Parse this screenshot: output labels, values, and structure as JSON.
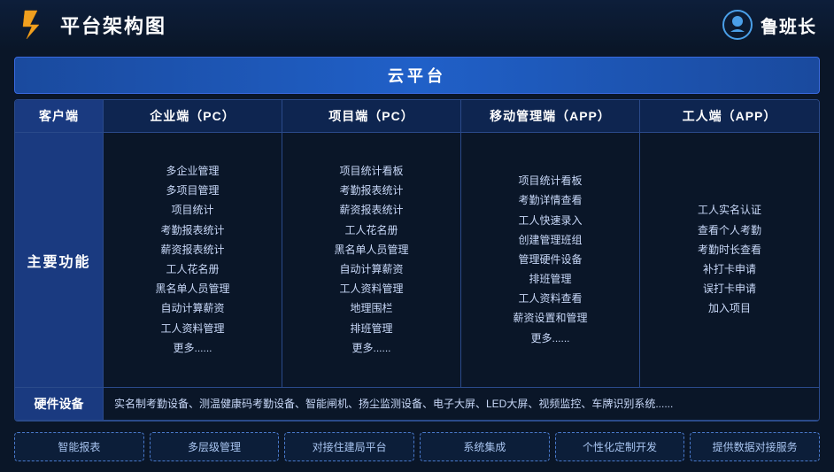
{
  "header": {
    "title": "平台架构图",
    "brand": "鲁班长"
  },
  "cloud_banner": "云平台",
  "columns": {
    "client": "客户端",
    "enterprise": "企业端（PC）",
    "project": "项目端（PC）",
    "mobile": "移动管理端（APP）",
    "worker": "工人端（APP）"
  },
  "main_label": "主要功能",
  "enterprise_features": [
    "多企业管理",
    "多项目管理",
    "项目统计",
    "考勤报表统计",
    "薪资报表统计",
    "工人花名册",
    "黑名单人员管理",
    "自动计算薪资",
    "工人资料管理",
    "更多......"
  ],
  "project_features": [
    "项目统计看板",
    "考勤报表统计",
    "薪资报表统计",
    "工人花名册",
    "黑名单人员管理",
    "自动计算薪资",
    "工人资料管理",
    "地理围栏",
    "排班管理",
    "更多......"
  ],
  "mobile_features": [
    "项目统计看板",
    "考勤详情查看",
    "工人快速录入",
    "创建管理班组",
    "管理硬件设备",
    "排班管理",
    "工人资料查看",
    "薪资设置和管理",
    "更多......"
  ],
  "worker_features": [
    "工人实名认证",
    "查看个人考勤",
    "考勤时长查看",
    "补打卡申请",
    "误打卡申请",
    "加入项目"
  ],
  "hardware_label": "硬件设备",
  "hardware_content": "实名制考勤设备、测温健康码考勤设备、智能闸机、扬尘监测设备、电子大屏、LED大屏、视频监控、车牌识别系统......",
  "tags": [
    "智能报表",
    "多层级管理",
    "对接住建局平台",
    "系统集成",
    "个性化定制开发",
    "提供数据对接服务"
  ]
}
